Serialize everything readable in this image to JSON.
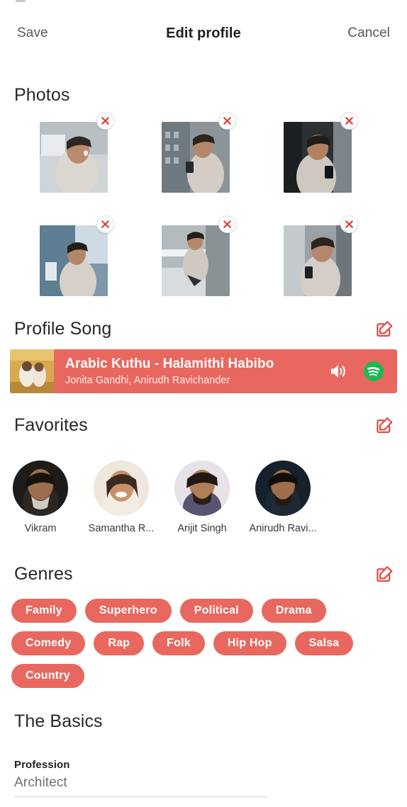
{
  "theme": {
    "accent": "#e8685f",
    "spotify_green": "#1db954",
    "text_dark": "#26292c",
    "text_muted": "#6d7175"
  },
  "header": {
    "save_label": "Save",
    "title": "Edit profile",
    "cancel_label": "Cancel"
  },
  "photos": {
    "heading": "Photos",
    "items": [
      {
        "alt": "man smiling outdoors with earbuds",
        "remove_label": "x"
      },
      {
        "alt": "man holding phone near brick building",
        "remove_label": "x"
      },
      {
        "alt": "man looking at phone in dark corridor",
        "remove_label": "x"
      },
      {
        "alt": "man walking past blue wall",
        "remove_label": "x"
      },
      {
        "alt": "man seated on railing using phone",
        "remove_label": "x"
      },
      {
        "alt": "man smiling holding phone on street",
        "remove_label": "x"
      }
    ]
  },
  "profile_song": {
    "heading": "Profile Song",
    "edit_label": "edit",
    "title": "Arabic Kuthu - Halamithi Habibo",
    "artists": "Jonita Gandhi, Anirudh Ravichander",
    "speaker_icon": "speaker-icon",
    "spotify_icon": "spotify-icon"
  },
  "favorites": {
    "heading": "Favorites",
    "edit_label": "edit",
    "items": [
      {
        "name": "Vikram"
      },
      {
        "name": "Samantha R..."
      },
      {
        "name": "Arijit Singh"
      },
      {
        "name": "Anirudh Ravi..."
      }
    ]
  },
  "genres": {
    "heading": "Genres",
    "edit_label": "edit",
    "items": [
      "Family",
      "Superhero",
      "Political",
      "Drama",
      "Comedy",
      "Rap",
      "Folk",
      "Hip Hop",
      "Salsa",
      "Country"
    ]
  },
  "basics": {
    "heading": "The Basics",
    "profession_label": "Profession",
    "profession_value": "Architect",
    "profession_placeholder": "Profession"
  }
}
